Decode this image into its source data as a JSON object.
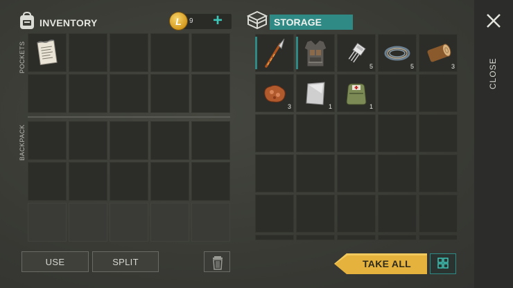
{
  "inventory": {
    "title": "INVENTORY",
    "pockets_label": "POCKETS",
    "backpack_label": "BACKPACK",
    "coins": "9",
    "pocket_items": [
      {
        "slot": 0,
        "name": "note-paper-icon",
        "qty": ""
      }
    ]
  },
  "storage": {
    "title": "STORAGE",
    "items": [
      {
        "slot": 0,
        "name": "crowbar-icon",
        "qty": ""
      },
      {
        "slot": 1,
        "name": "armor-vest-icon",
        "qty": ""
      },
      {
        "slot": 2,
        "name": "transistor-icon",
        "qty": "5"
      },
      {
        "slot": 3,
        "name": "wire-coil-icon",
        "qty": "5"
      },
      {
        "slot": 4,
        "name": "log-icon",
        "qty": "3"
      },
      {
        "slot": 5,
        "name": "raw-meat-icon",
        "qty": "3"
      },
      {
        "slot": 6,
        "name": "metal-plate-icon",
        "qty": "1"
      },
      {
        "slot": 7,
        "name": "medkit-bag-icon",
        "qty": "1"
      }
    ]
  },
  "side": {
    "close_label": "CLOSE"
  },
  "buttons": {
    "use": "USE",
    "split": "SPLIT",
    "take_all": "TAKE ALL"
  },
  "colors": {
    "accent_teal": "#2f8a86",
    "take_all_gold": "#e6b23e",
    "coin_gold": "#d59a1f",
    "slot_bg": "#2c2d29"
  }
}
